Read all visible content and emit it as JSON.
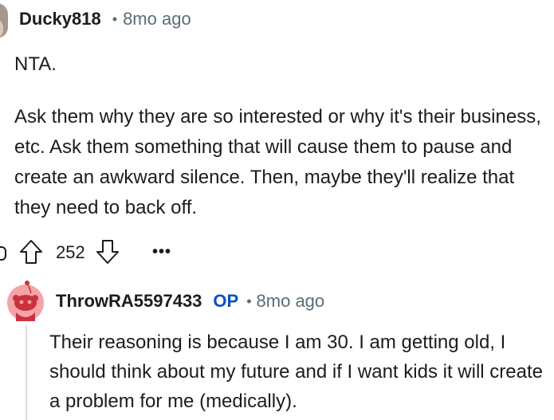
{
  "comment": {
    "username": "Ducky818",
    "separator": "•",
    "time": "8mo ago",
    "paragraphs": [
      "NTA.",
      "Ask them why they are so interested or why it's their business, etc. Ask them something that will cause them to pause and create an awkward silence. Then, maybe they'll realize that they need to back off."
    ],
    "score": "252",
    "more_label": "•••",
    "avatar_icon": "avatar-icon",
    "upvote_icon": "arrow-up-icon",
    "downvote_icon": "arrow-down-icon"
  },
  "reply": {
    "username": "ThrowRA5597433",
    "op_tag": "OP",
    "separator": "•",
    "time": "8mo ago",
    "text": "Their reasoning is because I am 30. I am getting old, I should think about my future and if I want kids it will create a problem for me (medically).",
    "avatar_icon": "snoo-avatar-icon",
    "avatar_color": "#f4a3a8"
  }
}
